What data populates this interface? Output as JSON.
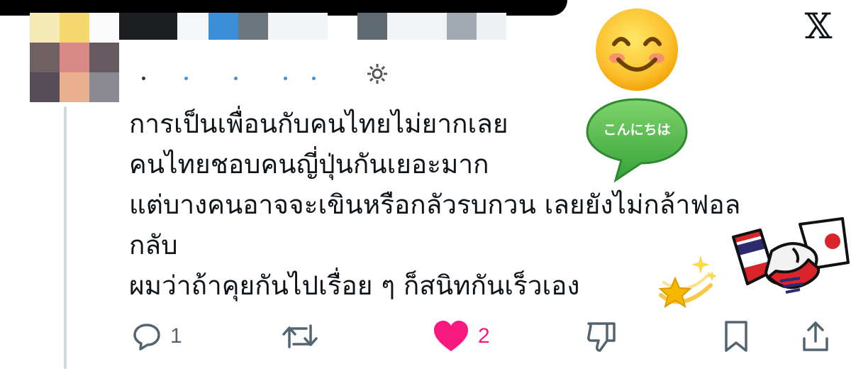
{
  "header": {
    "brand_icon": "x-logo",
    "brand_logo_text": "𝕏"
  },
  "post": {
    "lines": [
      "การเป็นเพื่อนกับคนไทยไม่ยากเลย",
      "คนไทยชอบคนญี่ปุ่นกันเยอะมาก",
      "แต่บางคนอาจจะเขินหรือกลัวรบกวน เลยยังไม่กล้าฟอล",
      "กลับ",
      "ผมว่าถ้าคุยกันไปเรื่อย ๆ ก็สนิทกันเร็วเอง"
    ]
  },
  "stickers": {
    "speech_bubble_text": "こんにちは",
    "smiley": "smiling-face",
    "sparkle": "dizzy-star",
    "handshake": "thailand-japan-handshake"
  },
  "actions": {
    "reply_count": "1",
    "retweet_count": "",
    "like_count": "2",
    "like_color": "#f91880"
  }
}
